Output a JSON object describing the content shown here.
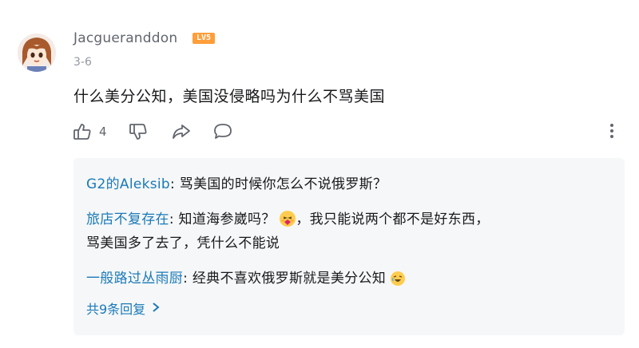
{
  "comment": {
    "username": "Jacgueranddon",
    "level_badge": "LV5",
    "date": "3-6",
    "content": "什么美分公知，美国没侵略吗为什么不骂美国",
    "like_count": "4"
  },
  "icons": {
    "like": "thumbs-up-icon",
    "dislike": "thumbs-down-icon",
    "share": "share-icon",
    "reply": "comment-icon",
    "more": "more-vertical-icon"
  },
  "replies": [
    {
      "name": "G2的Aleksib",
      "text": ": 骂美国的时候你怎么不说俄罗斯？"
    },
    {
      "name": "旅店不复存在",
      "text1": ": 知道海参崴吗？",
      "text2": "，我只能说两个都不是好东西，",
      "text3": "骂美国多了去了，凭什么不能说"
    },
    {
      "name": "一般路过丛雨厨",
      "text": ": 经典不喜欢俄罗斯就是美分公知"
    }
  ],
  "view_all_replies": "共9条回复",
  "colors": {
    "link": "#1a7ab8",
    "badge": "#ff9e3a",
    "text": "#18191c",
    "muted": "#9499a0"
  }
}
